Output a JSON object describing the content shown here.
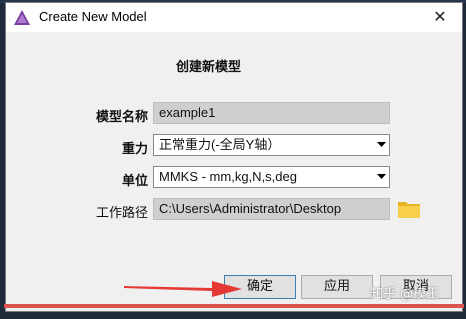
{
  "window": {
    "title": "Create New Model",
    "close_glyph": "✕",
    "app_icon": "app-logo-icon"
  },
  "form": {
    "heading": "创建新模型",
    "model_name": {
      "label": "模型名称",
      "value": "example1"
    },
    "gravity": {
      "label": "重力",
      "value": "正常重力(-全局Y轴）"
    },
    "units": {
      "label": "单位",
      "value": "MMKS - mm,kg,N,s,deg"
    },
    "working_dir": {
      "label": "工作路径",
      "value": "C:\\Users\\Administrator\\Desktop",
      "icon": "folder-icon"
    }
  },
  "buttons": {
    "ok": "确定",
    "apply": "应用",
    "cancel": "取消"
  },
  "watermark": "知乎 @模王",
  "colors": {
    "annotation_arrow": "#e53935",
    "folder": "#f4c430",
    "readonly_field": "#cfcfcf"
  }
}
